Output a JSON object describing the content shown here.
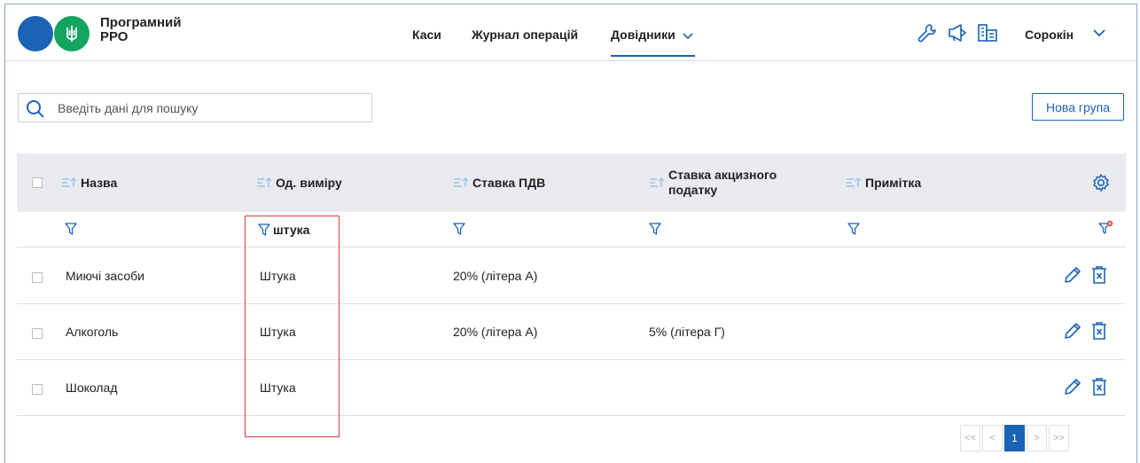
{
  "app": {
    "title_line1": "Програмний",
    "title_line2": "РРО"
  },
  "nav": [
    {
      "label": "Каси"
    },
    {
      "label": "Журнал операцій"
    },
    {
      "label": "Довідники"
    }
  ],
  "user": {
    "name": "Сорокін"
  },
  "search": {
    "placeholder": "Введіть дані для пошуку",
    "value": ""
  },
  "toolbar": {
    "new_group_label": "Нова група"
  },
  "table": {
    "columns": [
      "Назва",
      "Од. виміру",
      "Ставка ПДВ",
      "Ставка акцизного податку",
      "Примітка"
    ],
    "excise_line1": "Ставка акцизного",
    "excise_line2": "податку",
    "filter": {
      "unit": "штука"
    },
    "rows": [
      {
        "name": "Миючі засоби",
        "unit": "Штука",
        "vat": "20% (літера А)",
        "excise": "",
        "note": ""
      },
      {
        "name": "Алкоголь",
        "unit": "Штука",
        "vat": "20% (літера А)",
        "excise": "5% (літера Г)",
        "note": ""
      },
      {
        "name": "Шоколад",
        "unit": "Штука",
        "vat": "",
        "excise": "",
        "note": ""
      }
    ]
  },
  "pagination": {
    "first": "<<",
    "prev": "<",
    "current": "1",
    "next": ">",
    "last": ">>"
  },
  "colors": {
    "accent": "#1a63b5",
    "logo_green": "#12a560",
    "highlight": "#e13b3b"
  }
}
